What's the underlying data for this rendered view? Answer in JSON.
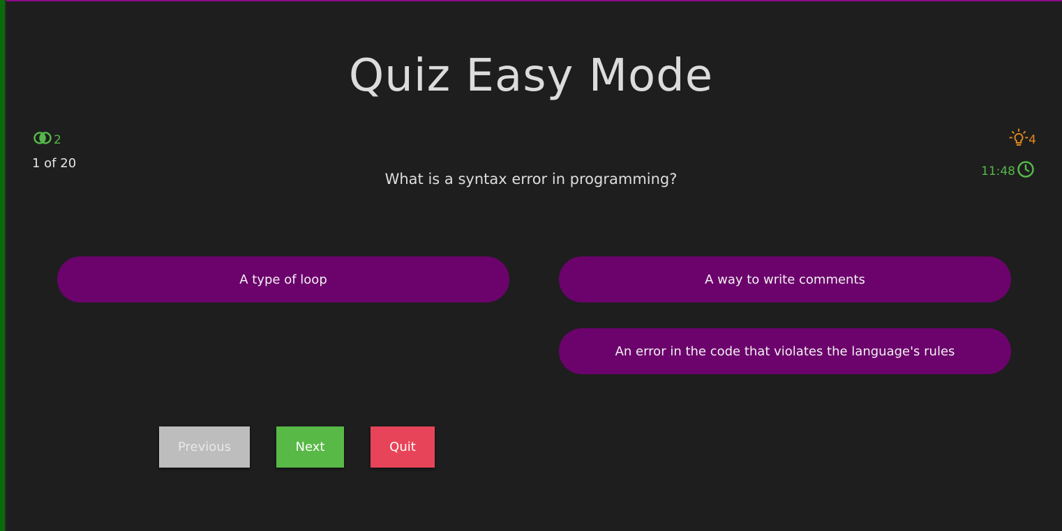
{
  "title": "Quiz Easy Mode",
  "status": {
    "lifelines_count": "2",
    "progress": "1 of 20",
    "hints_count": "4",
    "timer": "11:48"
  },
  "question": "What is a syntax error in programming?",
  "options": [
    {
      "label": "A type of loop"
    },
    {
      "label": "A way to write comments"
    },
    {
      "label": "An error in the code that violates the language's rules"
    }
  ],
  "buttons": {
    "previous": "Previous",
    "next": "Next",
    "quit": "Quit"
  },
  "colors": {
    "background": "#1e1e1e",
    "option_bg": "#6c036c",
    "accent_green": "#58b947",
    "quit_red": "#e84459",
    "hint_orange": "#e28a1a",
    "disabled_gray": "#bdbdbd"
  },
  "icons": {
    "lifelines": "fifty-fifty-icon",
    "hints": "lightbulb-icon",
    "timer": "clock-icon"
  }
}
